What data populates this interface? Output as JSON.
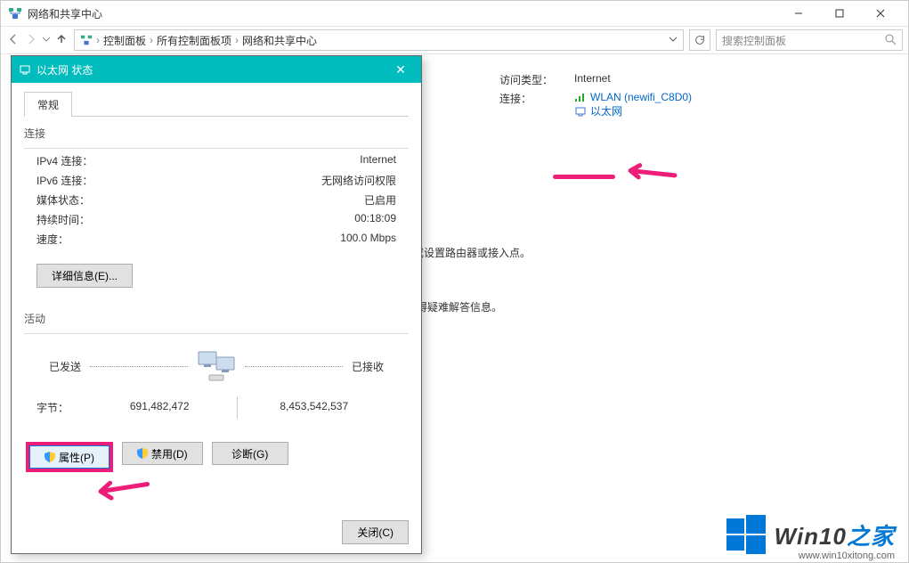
{
  "parent": {
    "title": "网络和共享中心",
    "path": [
      "控制面板",
      "所有控制面板项",
      "网络和共享中心"
    ],
    "search_placeholder": "搜索控制面板",
    "access_type_label": "访问类型：",
    "access_type_value": "Internet",
    "connections_label": "连接：",
    "wlan_link": "WLAN (newifi_C8D0)",
    "ethernet_link": "以太网",
    "text_router": "或设置路由器或接入点。",
    "text_diag": "获得疑难解答信息。"
  },
  "dialog": {
    "title": "以太网 状态",
    "tab_general": "常规",
    "group_connection": "连接",
    "ipv4_label": "IPv4 连接：",
    "ipv4_value": "Internet",
    "ipv6_label": "IPv6 连接：",
    "ipv6_value": "无网络访问权限",
    "media_label": "媒体状态：",
    "media_value": "已启用",
    "duration_label": "持续时间：",
    "duration_value": "00:18:09",
    "speed_label": "速度：",
    "speed_value": "100.0 Mbps",
    "details_btn": "详细信息(E)...",
    "group_activity": "活动",
    "sent_label": "已发送",
    "recv_label": "已接收",
    "bytes_label": "字节：",
    "bytes_sent": "691,482,472",
    "bytes_recv": "8,453,542,537",
    "properties_btn": "属性(P)",
    "disable_btn": "禁用(D)",
    "diagnose_btn": "诊断(G)",
    "close_btn": "关闭(C)"
  },
  "watermark": {
    "brand_pre": "Win10",
    "brand_post": "之家",
    "url": "www.win10xitong.com"
  }
}
